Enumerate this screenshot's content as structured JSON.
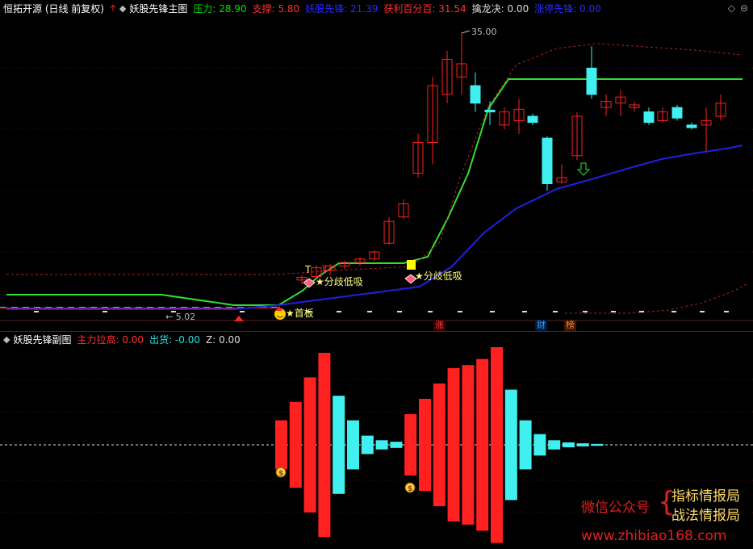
{
  "header": {
    "title": "恒拓开源 (日线 前复权)",
    "indicator_name": "妖股先锋主图",
    "items": [
      {
        "label": "压力: 28.90",
        "color": "#00e000"
      },
      {
        "label": "支撑: 5.80",
        "color": "#ff3030"
      },
      {
        "label": "妖股先锋: 21.39",
        "color": "#2a2aff"
      },
      {
        "label": "获利百分百: 31.54",
        "color": "#ff3030"
      },
      {
        "label": "擒龙决: 0.00",
        "color": "#dddddd"
      },
      {
        "label": "涨停先锋: 0.00",
        "color": "#2a2aff"
      }
    ]
  },
  "sub_header": {
    "indicator_name": "妖股先锋副图",
    "items": [
      {
        "label": "主力拉高: 0.00",
        "color": "#ff3030"
      },
      {
        "label": "出货: -0.00",
        "color": "#20e0e0"
      },
      {
        "label": "Z: 0.00",
        "color": "#dddddd"
      }
    ]
  },
  "annotations": {
    "high_price": "35.00",
    "low_price": "5.02",
    "signal1": "分歧低吸",
    "signal2": "分歧低吸",
    "signal3": "首板",
    "marker_t": "T",
    "tag_zhang": "涨",
    "tag_cai": "财",
    "tag_bang": "榜"
  },
  "watermark": {
    "wechat": "微信公众号",
    "line1": "指标情报局",
    "line2": "战法情报局",
    "url": "www.zhibiao168.com"
  },
  "colors": {
    "up": "#ff2020",
    "down": "#40f0f0",
    "green_line": "#30e030",
    "blue_line": "#2020e0",
    "dash_red": "#b02020",
    "bg": "#000000"
  },
  "chart_data": {
    "type": "candlestick",
    "candles": [
      {
        "o": 6.8,
        "h": 7.3,
        "l": 6.3,
        "c": 7.1
      },
      {
        "o": 7.2,
        "h": 8.5,
        "l": 7.0,
        "c": 8.2
      },
      {
        "o": 7.9,
        "h": 8.6,
        "l": 7.4,
        "c": 8.4
      },
      {
        "o": 8.4,
        "h": 9.0,
        "l": 8.0,
        "c": 8.8
      },
      {
        "o": 8.8,
        "h": 9.4,
        "l": 8.4,
        "c": 9.2
      },
      {
        "o": 9.2,
        "h": 10.2,
        "l": 9.0,
        "c": 10.0
      },
      {
        "o": 11.0,
        "h": 14.0,
        "l": 10.8,
        "c": 13.5
      },
      {
        "o": 14.0,
        "h": 16.0,
        "l": 13.8,
        "c": 15.5
      },
      {
        "o": 19.0,
        "h": 23.5,
        "l": 18.5,
        "c": 22.5
      },
      {
        "o": 22.5,
        "h": 30.0,
        "l": 20.0,
        "c": 29.0
      },
      {
        "o": 28.0,
        "h": 33.0,
        "l": 27.0,
        "c": 32.0
      },
      {
        "o": 30.0,
        "h": 35.0,
        "l": 28.0,
        "c": 31.5
      },
      {
        "o": 29.0,
        "h": 30.5,
        "l": 26.0,
        "c": 27.0
      },
      {
        "o": 26.2,
        "h": 27.2,
        "l": 24.5,
        "c": 26.0
      },
      {
        "o": 24.5,
        "h": 26.5,
        "l": 24.0,
        "c": 26.0
      },
      {
        "o": 25.0,
        "h": 27.5,
        "l": 23.5,
        "c": 26.3
      },
      {
        "o": 25.5,
        "h": 25.8,
        "l": 24.5,
        "c": 24.8
      },
      {
        "o": 23.0,
        "h": 23.2,
        "l": 17.0,
        "c": 17.8
      },
      {
        "o": 18.0,
        "h": 20.0,
        "l": 17.8,
        "c": 18.5
      },
      {
        "o": 21.0,
        "h": 26.0,
        "l": 20.5,
        "c": 25.5
      },
      {
        "o": 31.0,
        "h": 33.5,
        "l": 27.5,
        "c": 28.0
      },
      {
        "o": 26.5,
        "h": 28.0,
        "l": 25.5,
        "c": 27.2
      },
      {
        "o": 27.0,
        "h": 28.5,
        "l": 25.5,
        "c": 27.7
      },
      {
        "o": 26.5,
        "h": 27.2,
        "l": 26.0,
        "c": 26.8
      },
      {
        "o": 26.0,
        "h": 26.5,
        "l": 24.5,
        "c": 24.8
      },
      {
        "o": 25.0,
        "h": 26.5,
        "l": 24.8,
        "c": 26.0
      },
      {
        "o": 26.5,
        "h": 26.8,
        "l": 25.0,
        "c": 25.3
      },
      {
        "o": 24.5,
        "h": 24.8,
        "l": 24.0,
        "c": 24.2
      },
      {
        "o": 24.5,
        "h": 26.5,
        "l": 21.5,
        "c": 25.0
      },
      {
        "o": 25.5,
        "h": 28.0,
        "l": 25.0,
        "c": 27.0
      }
    ],
    "sub_bars": [
      {
        "v": 8,
        "c": "up"
      },
      {
        "v": 14,
        "c": "up"
      },
      {
        "v": 22,
        "c": "up"
      },
      {
        "v": 30,
        "c": "up"
      },
      {
        "v": -16,
        "c": "down"
      },
      {
        "v": -8,
        "c": "down"
      },
      {
        "v": -3,
        "c": "down"
      },
      {
        "v": -1.5,
        "c": "down"
      },
      {
        "v": -1,
        "c": "down"
      },
      {
        "v": 10,
        "c": "up"
      },
      {
        "v": 15,
        "c": "up"
      },
      {
        "v": 20,
        "c": "up"
      },
      {
        "v": 25,
        "c": "up"
      },
      {
        "v": 26,
        "c": "up"
      },
      {
        "v": 28,
        "c": "up"
      },
      {
        "v": 32,
        "c": "up"
      },
      {
        "v": -18,
        "c": "down"
      },
      {
        "v": -8,
        "c": "down"
      },
      {
        "v": -3.5,
        "c": "down"
      },
      {
        "v": -1.5,
        "c": "down"
      },
      {
        "v": -0.8,
        "c": "down"
      },
      {
        "v": -0.5,
        "c": "down"
      },
      {
        "v": -0.3,
        "c": "down"
      }
    ]
  }
}
